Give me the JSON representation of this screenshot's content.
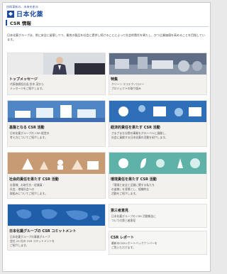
{
  "header": {
    "tagline": "技術革新の、未来を創る",
    "logo": "日本化薬",
    "title": "CSR 情報"
  },
  "intro": "日本化薬グループは、常に安全に留意しつつ、最良の製品を社会に提供し続けることによって社会的責任を果たし、かつ企業価値を高めることを目指しています。",
  "cards": [
    {
      "title": "トップメッセージ",
      "desc": "代表取締役社長 鈴木 茂から\nメッセージをご紹介します。"
    },
    {
      "title": "特集",
      "desc": "クリーン エコテクノロジー\nプロジェクトの取り組み"
    },
    {
      "title": "基盤となる CSR 活動",
      "desc": "日本化薬グループの CSR 経営の\n考え方についてご紹介します。"
    },
    {
      "title": "経済的責任を果たす CSR 活動",
      "desc": "さまざまな分野の事業をグローバルに展開し、\n社会に貢献する日本化薬の活動を紹介します。"
    },
    {
      "title": "社会的責任を果たす CSR 活動",
      "desc": "お客様、お取引先・従業員・\n社会、地域社会への\n取組みについてご紹介します。"
    },
    {
      "title": "環境責任を果たす CSR 活動",
      "desc": "「環境と安全と品質に関する私たち\nの姿勢」を背景とし、組織的な\n活動をご紹介します。"
    },
    {
      "title": "日本化薬グループの CSR コミットメント",
      "desc": "日本化薬グループの事業グループ\n会社 25 社の CSR コミットメントを\nご紹介します。"
    },
    {
      "title": "第三者意見",
      "desc": "日本化薬グループの CSR 活動報告に\nついての第三者意見"
    },
    {
      "title": "CSR レポート",
      "desc": "最新のCSRレポートバックナンバーを\nご覧いただけます。"
    }
  ]
}
